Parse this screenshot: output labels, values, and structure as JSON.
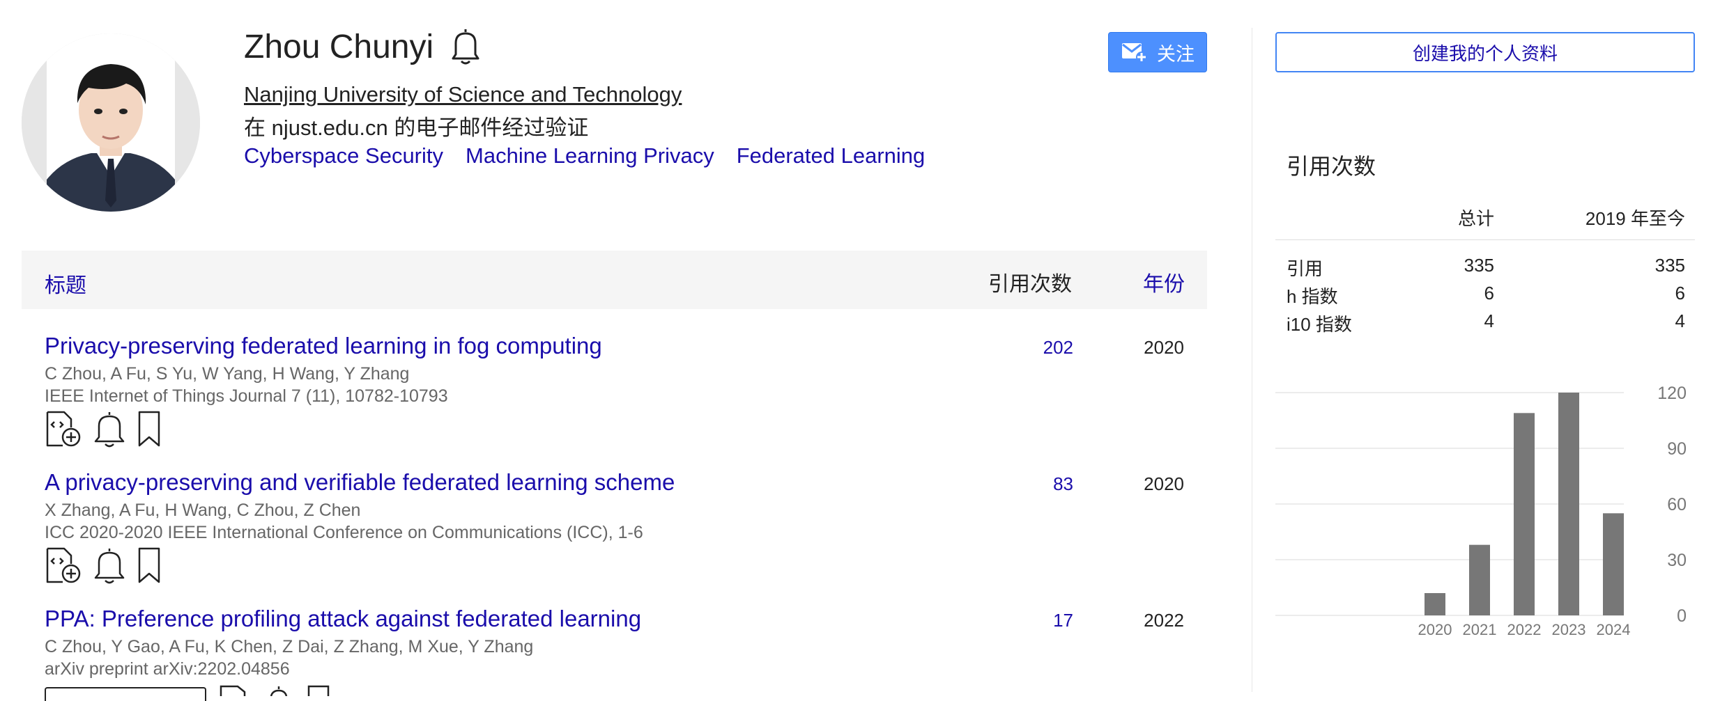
{
  "profile": {
    "name": "Zhou Chunyi",
    "affiliation": "Nanjing University of Science and Technology",
    "verified_email": "在 njust.edu.cn 的电子邮件经过验证",
    "interests": [
      "Cyberspace Security",
      "Machine Learning Privacy",
      "Federated Learning"
    ]
  },
  "actions": {
    "follow_label": "关注",
    "create_profile_label": "创建我的个人资料"
  },
  "table": {
    "header": {
      "title": "标题",
      "cited_by": "引用次数",
      "year": "年份"
    },
    "rows": [
      {
        "title": "Privacy-preserving federated learning in fog computing",
        "authors": "C Zhou, A Fu, S Yu, W Yang, H Wang, Y Zhang",
        "venue": "IEEE Internet of Things Journal 7 (11), 10782-10793",
        "cited_by": "202",
        "year": "2020"
      },
      {
        "title": "A privacy-preserving and verifiable federated learning scheme",
        "authors": "X Zhang, A Fu, H Wang, C Zhou, Z Chen",
        "venue": "ICC 2020-2020 IEEE International Conference on Communications (ICC), 1-6",
        "cited_by": "83",
        "year": "2020"
      },
      {
        "title": "PPA: Preference profiling attack against federated learning",
        "authors": "C Zhou, Y Gao, A Fu, K Chen, Z Dai, Z Zhang, M Xue, Y Zhang",
        "venue": "arXiv preprint arXiv:2202.04856",
        "cited_by": "17",
        "year": "2022"
      }
    ]
  },
  "citations": {
    "title": "引用次数",
    "col_total": "总计",
    "col_since": "2019 年至今",
    "rows": [
      {
        "label": "引用",
        "total": "335",
        "since": "335"
      },
      {
        "label": "h 指数",
        "total": "6",
        "since": "6"
      },
      {
        "label": "i10 指数",
        "total": "4",
        "since": "4"
      }
    ]
  },
  "chart_data": {
    "type": "bar",
    "categories": [
      "2020",
      "2021",
      "2022",
      "2023",
      "2024"
    ],
    "values": [
      12,
      38,
      109,
      120,
      55
    ],
    "ylim": [
      0,
      120
    ],
    "yticks": [
      0,
      30,
      60,
      90,
      120
    ],
    "grid": true,
    "color": "#777777"
  },
  "colors": {
    "link": "#1a0dab",
    "follow_bg": "#4d90fe",
    "bar": "#777777"
  }
}
